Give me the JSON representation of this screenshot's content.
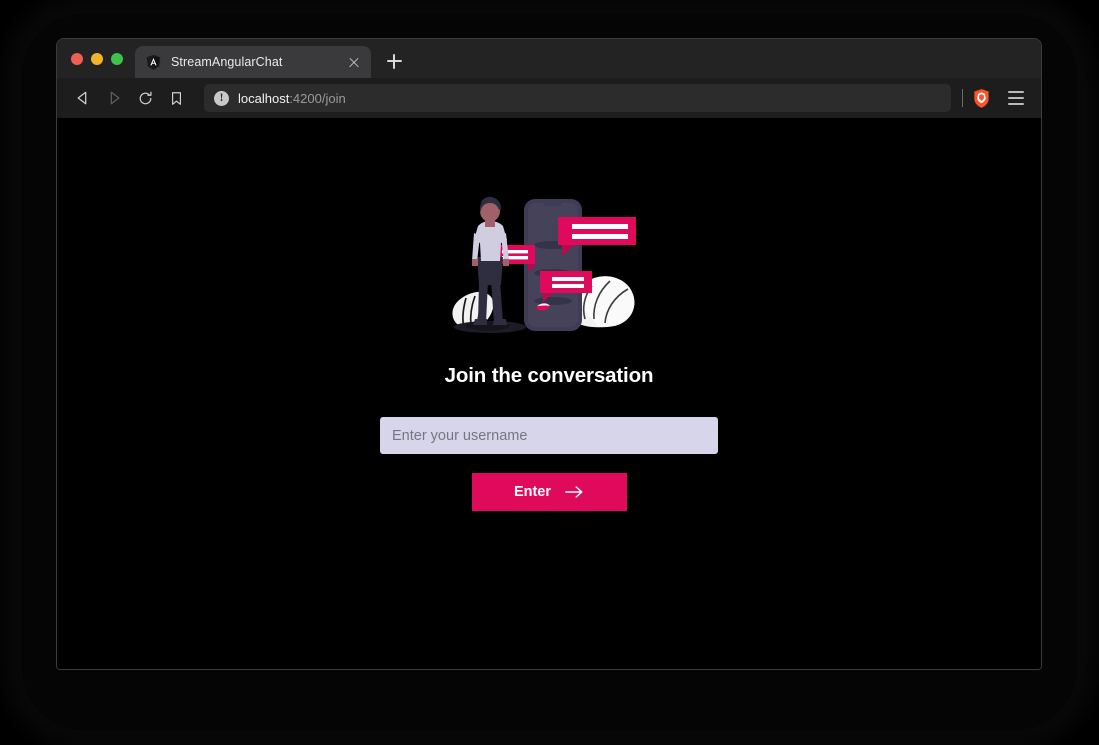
{
  "window": {
    "traffic_lights": [
      {
        "name": "close",
        "color": "#ef5f56"
      },
      {
        "name": "minimize",
        "color": "#f0b429"
      },
      {
        "name": "maximize",
        "color": "#3ec14d"
      }
    ]
  },
  "browser": {
    "tab": {
      "title": "StreamAngularChat",
      "favicon": "angular-logo-icon",
      "close_icon": "close-icon"
    },
    "new_tab_icon": "plus-icon",
    "nav": {
      "back_icon": "back-arrow-icon",
      "forward_icon": "forward-arrow-icon",
      "reload_icon": "reload-icon",
      "bookmark_icon": "bookmark-icon"
    },
    "address_bar": {
      "security_icon": "info-circle-icon",
      "host": "localhost",
      "path": ":4200/join",
      "full_url": "localhost:4200/join"
    },
    "shields_icon": "brave-shield-icon",
    "menu_icon": "hamburger-menu-icon"
  },
  "page": {
    "illustration": "chat-conversation-illustration",
    "title": "Join the conversation",
    "username_field": {
      "value": "",
      "placeholder": "Enter your username"
    },
    "enter_button": {
      "label": "Enter",
      "icon": "arrow-right-icon"
    }
  },
  "colors": {
    "page_background": "#000000",
    "accent_pink": "#e00a5d",
    "input_background": "#d7d5ea",
    "tab_active": "#3a3a3c",
    "tabstrip": "#232323",
    "toolbar": "#1d1d1d",
    "illustration_dark": "#3f3d56",
    "illustration_light": "#f2f2f2",
    "brave_orange": "#fb542b"
  }
}
